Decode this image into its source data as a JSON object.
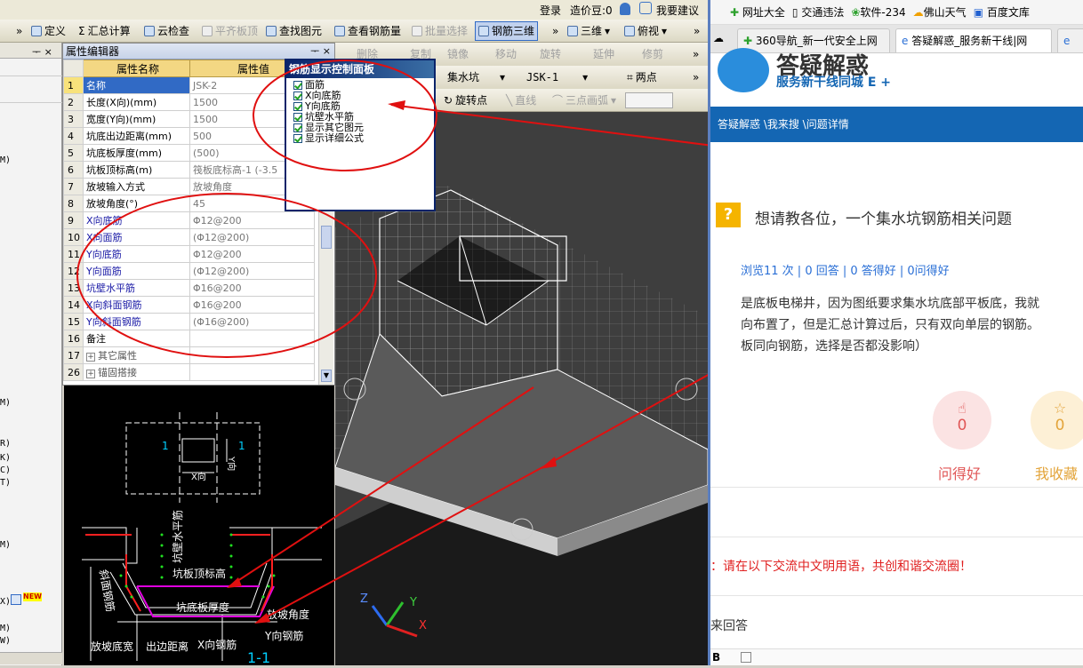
{
  "topbar": {
    "login": "登录",
    "price_bean": "造价豆:0",
    "feedback": "我要建议"
  },
  "toolbar1": {
    "items": [
      "定义",
      "汇总计算",
      "云检查",
      "平齐板顶",
      "查找图元",
      "查看钢筋量",
      "批量选择",
      "钢筋三维",
      "三维",
      "俯视"
    ],
    "sigma": "Σ"
  },
  "left_strip_chars": [
    "M)",
    "M)",
    "R)",
    "K)",
    "C)",
    "T)",
    "M)",
    "X)",
    "M)",
    "W)"
  ],
  "new_badge": "NEW",
  "prop_panel": {
    "title": "属性编辑器",
    "pin": "ᅮ ×",
    "col_name": "属性名称",
    "col_value": "属性值",
    "rows": [
      {
        "num": "1",
        "name": "名称",
        "value": "JSK-2"
      },
      {
        "num": "2",
        "name": "长度(X向)(mm)",
        "value": "1500"
      },
      {
        "num": "3",
        "name": "宽度(Y向)(mm)",
        "value": "1500"
      },
      {
        "num": "4",
        "name": "坑底出边距离(mm)",
        "value": "500"
      },
      {
        "num": "5",
        "name": "坑底板厚度(mm)",
        "value": "(500)"
      },
      {
        "num": "6",
        "name": "坑板顶标高(m)",
        "value": "筏板底标高-1 (-3.5"
      },
      {
        "num": "7",
        "name": "放坡输入方式",
        "value": "放坡角度"
      },
      {
        "num": "8",
        "name": "放坡角度(°)",
        "value": "45"
      },
      {
        "num": "9",
        "name": "X向底筋",
        "value": "Φ12@200"
      },
      {
        "num": "10",
        "name": "X向面筋",
        "value": "(Φ12@200)"
      },
      {
        "num": "11",
        "name": "Y向底筋",
        "value": "Φ12@200"
      },
      {
        "num": "12",
        "name": "Y向面筋",
        "value": "(Φ12@200)"
      },
      {
        "num": "13",
        "name": "坑壁水平筋",
        "value": "Φ16@200"
      },
      {
        "num": "14",
        "name": "X向斜面钢筋",
        "value": "Φ16@200"
      },
      {
        "num": "15",
        "name": "Y向斜面钢筋",
        "value": "(Φ16@200)"
      },
      {
        "num": "16",
        "name": "备注",
        "value": ""
      },
      {
        "num": "17",
        "name": "其它属性",
        "value": ""
      },
      {
        "num": "26",
        "name": "锚固搭接",
        "value": ""
      }
    ]
  },
  "diagram": {
    "x_dir": "X向",
    "y_dir": "Y向",
    "mark1": "1",
    "mark2": "1",
    "wall_horizontal": "坑壁水平筋",
    "slope_rebar": "斜面钢筋",
    "top_elev": "坑板顶标高",
    "bottom_thickness": "坑底板厚度",
    "slope_angle": "放坡角度",
    "y_rebar": "Y向钢筋",
    "slope_width": "放坡底宽",
    "edge_dist": "出边距离",
    "x_rebar": "X向钢筋",
    "section": "1-1"
  },
  "toolbar2": {
    "row1": [
      "删除",
      "复制",
      "镜像",
      "移动",
      "旋转",
      "延伸",
      "修剪"
    ],
    "type": "集水坑",
    "name": "JSK-1",
    "two_points": "两点",
    "rotate_point": "旋转点",
    "line": "直线",
    "three_arc": "三点画弧"
  },
  "rebar_panel": {
    "title": "钢筋显示控制面板",
    "items": [
      "面筋",
      "X向底筋",
      "Y向底筋",
      "坑壁水平筋",
      "显示其它图元",
      "显示详细公式"
    ]
  },
  "axis": {
    "x": "X",
    "y": "Y",
    "z": "Z"
  },
  "browser": {
    "bookmarks": [
      "网址大全",
      "交通违法",
      "软件-234",
      "佛山天气",
      "百度文库"
    ],
    "tabs": [
      "360导航_新一代安全上网",
      "答疑解惑_服务新干线|网"
    ],
    "brand": "答疑解惑",
    "brand_sub": "服务新干线同城 E +",
    "breadcrumb": "答疑解惑 \\我来搜 \\问题详情",
    "question_title": "想请教各位，一个集水坑钢筋相关问题",
    "stats": "浏览11 次 | 0 回答 | 0 答得好 | 0问得好",
    "body_lines": [
      "是底板电梯井，因为图纸要求集水坑底部平板底，我就",
      "向布置了，但是汇总计算过后，只有双向单层的钢筋。",
      "板同向钢筋，选择是否都没影响）"
    ],
    "like_count": "0",
    "like_label": "问得好",
    "fav_count": "0",
    "fav_label": "我收藏",
    "notice": "：请在以下交流中文明用语，共创和谐交流圈！",
    "answer": "来回答",
    "editor_b": "B"
  }
}
